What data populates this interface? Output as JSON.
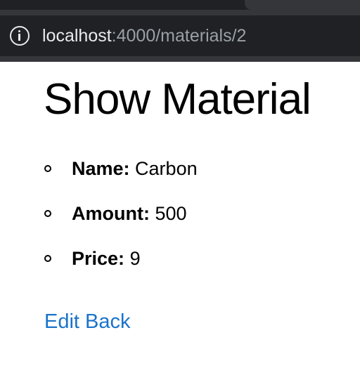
{
  "browser": {
    "url_host": "localhost",
    "url_path": ":4000/materials/2"
  },
  "page": {
    "title": "Show Material",
    "details": [
      {
        "label": "Name:",
        "value": "Carbon"
      },
      {
        "label": "Amount:",
        "value": "500"
      },
      {
        "label": "Price:",
        "value": "9"
      }
    ],
    "links": {
      "edit": "Edit",
      "back": "Back"
    },
    "colors": {
      "link": "#1a73c9",
      "chrome_bg": "#35363a",
      "omnibox_bg": "#202124"
    }
  }
}
